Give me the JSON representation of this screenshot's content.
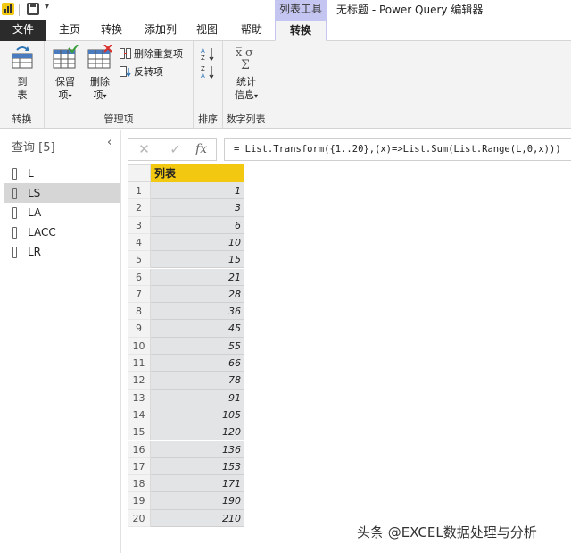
{
  "titlebar": {
    "context_tab_group": "列表工具",
    "window_title": "无标题 - Power Query 编辑器",
    "qat_dropdown": "▾"
  },
  "tabs": [
    "文件",
    "主页",
    "转换",
    "添加列",
    "视图",
    "帮助",
    "转换"
  ],
  "ribbon": {
    "to_table": [
      "到",
      "表"
    ],
    "keep_items": [
      "保留",
      "项"
    ],
    "remove_items": [
      "删除",
      "项"
    ],
    "remove_duplicates": "删除重复项",
    "reverse_items": "反转项",
    "statistics": [
      "统计",
      "信息"
    ],
    "group_convert": "转换",
    "group_manage": "管理项",
    "group_sort": "排序",
    "group_numeric": "数字列表"
  },
  "sidebar": {
    "title": "查询 [5]",
    "collapse": "‹",
    "queries": [
      "L",
      "LS",
      "LA",
      "LACC",
      "LR"
    ],
    "selected": "LS"
  },
  "formula": {
    "cancel": "✕",
    "confirm": "✓",
    "fx": "fx",
    "text": "= List.Transform({1..20},(x)=>List.Sum(List.Range(L,0,x)))"
  },
  "grid": {
    "column": "列表",
    "rows": [
      {
        "i": "1",
        "v": "1"
      },
      {
        "i": "2",
        "v": "3"
      },
      {
        "i": "3",
        "v": "6"
      },
      {
        "i": "4",
        "v": "10"
      },
      {
        "i": "5",
        "v": "15"
      },
      {
        "i": "6",
        "v": "21"
      },
      {
        "i": "7",
        "v": "28"
      },
      {
        "i": "8",
        "v": "36"
      },
      {
        "i": "9",
        "v": "45"
      },
      {
        "i": "10",
        "v": "55"
      },
      {
        "i": "11",
        "v": "66"
      },
      {
        "i": "12",
        "v": "78"
      },
      {
        "i": "13",
        "v": "91"
      },
      {
        "i": "14",
        "v": "105"
      },
      {
        "i": "15",
        "v": "120"
      },
      {
        "i": "16",
        "v": "136"
      },
      {
        "i": "17",
        "v": "153"
      },
      {
        "i": "18",
        "v": "171"
      },
      {
        "i": "19",
        "v": "190"
      },
      {
        "i": "20",
        "v": "210"
      }
    ]
  },
  "watermark": "头条 @EXCEL数据处理与分析",
  "colors": {
    "accent": "#f2c811",
    "context_tab": "#c5c5f1",
    "file_tab": "#2b2b2b",
    "selected_query": "#d6d6d6"
  }
}
